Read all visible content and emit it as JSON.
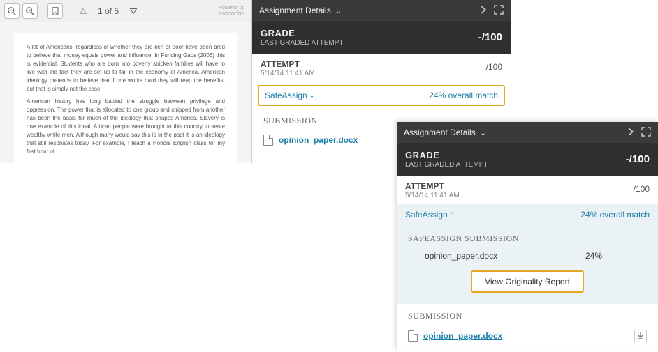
{
  "viewer": {
    "page_indicator": "1 of 5",
    "powered_label": "Powered by",
    "powered_brand": "crocodoc"
  },
  "document": {
    "para1": "A lot of Americans, regardless of whether they are rich or poor have been bred to believe that money equals power and influence. In Funding Gaps (2006) this is evidential. Students who are born into poverty stricken families will have to live with the fact they are set up to fail in the economy of America. American ideology pretends to believe that if one works hard they will reap the benefits, but that is simply not the case.",
    "para2": "American history has long battled the struggle between privilege and oppression. The power that is allocated to one group and stripped from another has been the basis for much of the ideology that shapes America. Slavery is one example of this ideal. African people were brought to this country to serve wealthy white men. Although many would say this is in the past it is an ideology that still resonates today. For example, I teach a Honors English class for my first hour of"
  },
  "panel_back": {
    "header": "Assignment Details",
    "grade": {
      "title": "GRADE",
      "sub": "LAST GRADED ATTEMPT",
      "score_dash": "-",
      "score_denom": "/100"
    },
    "attempt": {
      "title": "ATTEMPT",
      "time": "5/14/14 11:41 AM",
      "score": "/100"
    },
    "safeassign": {
      "label": "SafeAssign",
      "match": "24% overall match"
    },
    "submission_label": "SUBMISSION",
    "file": "opinion_paper.docx"
  },
  "panel_front": {
    "header": "Assignment Details",
    "grade": {
      "title": "GRADE",
      "sub": "LAST GRADED ATTEMPT",
      "score_dash": "-",
      "score_denom": "/100"
    },
    "attempt": {
      "title": "ATTEMPT",
      "time": "5/14/14 11:41 AM",
      "score": "/100"
    },
    "safeassign": {
      "label": "SafeAssign",
      "match": "24% overall match"
    },
    "sa_submission_label": "SAFEASSIGN SUBMISSION",
    "sa_file": "opinion_paper.docx",
    "sa_pct": "24%",
    "originality_btn": "View Originality Report",
    "submission_label": "SUBMISSION",
    "file": "opinion_paper.docx"
  }
}
